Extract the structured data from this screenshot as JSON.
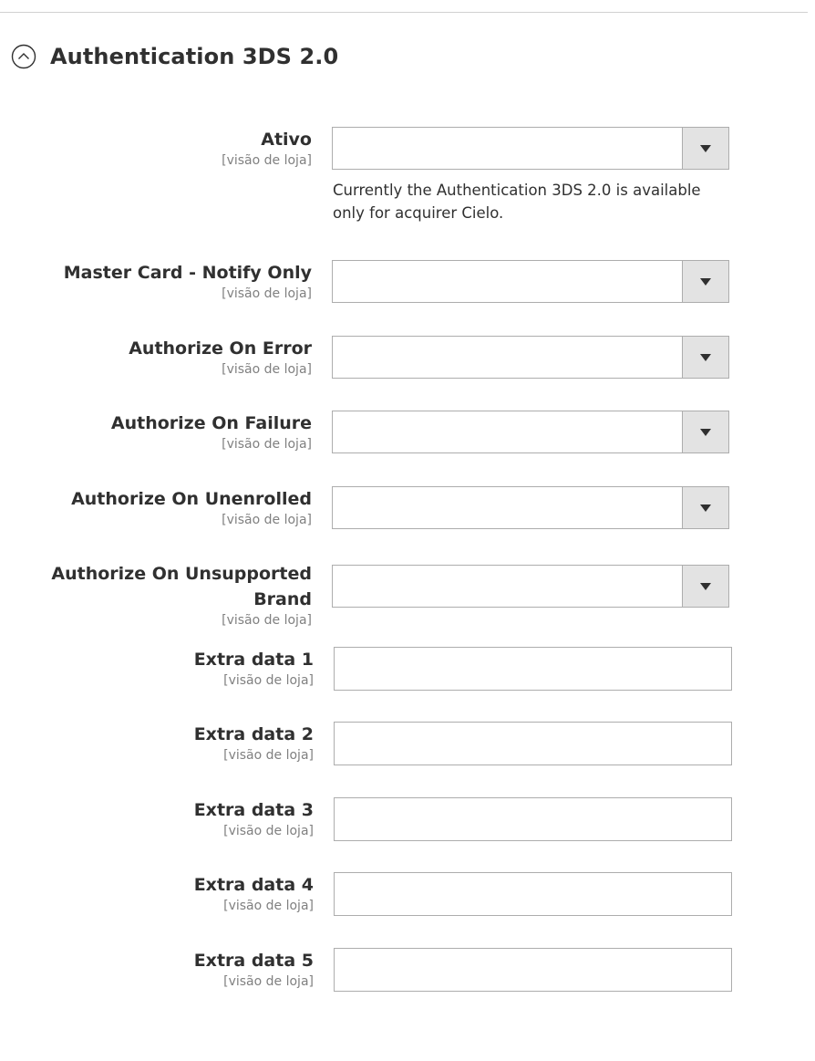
{
  "section": {
    "title": "Authentication 3DS 2.0",
    "collapse_icon": "chevron-up-circle-icon"
  },
  "scope_label": "[visão de loja]",
  "fields": {
    "ativo": {
      "label": "Ativo",
      "value": "",
      "note": "Currently the Authentication 3DS 2.0 is available only for acquirer Cielo."
    },
    "mastercard_notify_only": {
      "label": "Master Card - Notify Only",
      "value": ""
    },
    "authorize_on_error": {
      "label": "Authorize On Error",
      "value": ""
    },
    "authorize_on_failure": {
      "label": "Authorize On Failure",
      "value": ""
    },
    "authorize_on_unenrolled": {
      "label": "Authorize On Unenrolled",
      "value": ""
    },
    "authorize_on_unsupported_brand": {
      "label_line1": "Authorize On Unsupported",
      "label_line2": "Brand",
      "value": ""
    },
    "extra_data_1": {
      "label": "Extra data 1",
      "value": ""
    },
    "extra_data_2": {
      "label": "Extra data 2",
      "value": ""
    },
    "extra_data_3": {
      "label": "Extra data 3",
      "value": ""
    },
    "extra_data_4": {
      "label": "Extra data 4",
      "value": ""
    },
    "extra_data_5": {
      "label": "Extra data 5",
      "value": ""
    }
  },
  "colors": {
    "text": "#303030",
    "muted": "#808080",
    "border": "#adadad",
    "arrow_bg": "#e3e3e3",
    "divider": "#d1d1d1"
  }
}
